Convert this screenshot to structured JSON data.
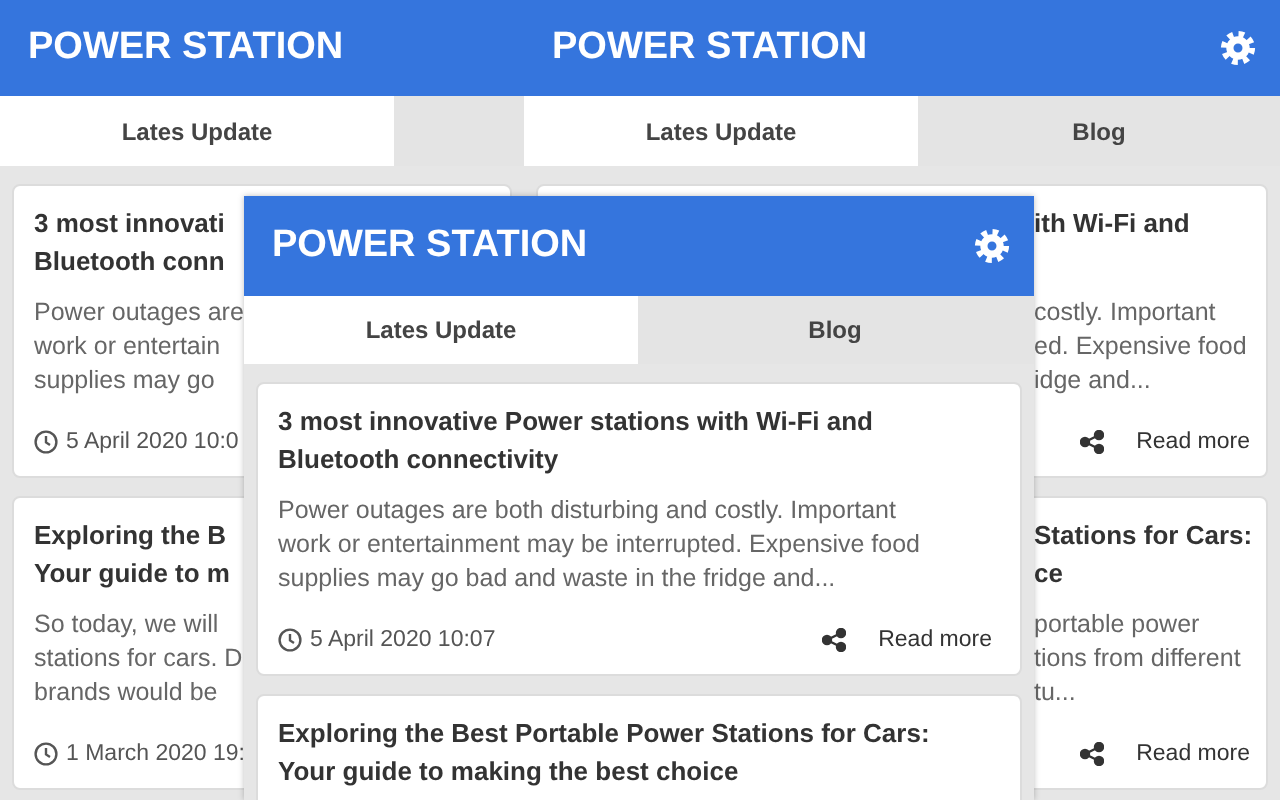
{
  "windows": [
    {
      "kind": "back-left",
      "header": {
        "title": "POWER STATION"
      },
      "tabs": [
        {
          "label": "Lates Update",
          "selected": true
        }
      ],
      "cards": [
        {
          "title_lines": [
            "3 most innovati",
            "Bluetooth conn"
          ],
          "excerpt_lines": [
            "Power outages are",
            "work or entertain",
            "supplies may go"
          ],
          "date": "5 April 2020 10:0"
        },
        {
          "title_lines": [
            "Exploring the B",
            "Your guide to m"
          ],
          "excerpt_lines": [
            "So today, we will",
            "stations for cars. D",
            "brands would be"
          ],
          "date": "1 March 2020 19:"
        }
      ]
    },
    {
      "kind": "back-right",
      "header": {
        "title": "POWER STATION",
        "settings_icon": true
      },
      "tabs": [
        {
          "label": "Lates Update",
          "selected": true
        },
        {
          "label": "Blog",
          "selected": false
        }
      ],
      "cards": [
        {
          "title_lines": [
            "ith Wi-Fi and"
          ],
          "excerpt_lines": [
            "costly. Important",
            "ed. Expensive food",
            "idge and..."
          ],
          "read_more": "Read more"
        },
        {
          "title_lines": [
            "Stations for Cars:",
            "ce"
          ],
          "excerpt_lines": [
            "portable power",
            "tions from different",
            "tu..."
          ],
          "read_more": "Read more"
        }
      ]
    },
    {
      "kind": "front",
      "header": {
        "title": "POWER STATION",
        "settings_icon": true
      },
      "tabs": [
        {
          "label": "Lates Update",
          "selected": true
        },
        {
          "label": "Blog",
          "selected": false
        }
      ],
      "cards": [
        {
          "title_lines": [
            "3 most innovative Power stations with Wi-Fi and",
            "Bluetooth connectivity"
          ],
          "excerpt_lines": [
            "Power outages are both disturbing and costly. Important",
            "work or entertainment may be interrupted. Expensive food",
            "supplies may go bad and waste in the fridge and..."
          ],
          "date": "5 April 2020 10:07",
          "read_more": "Read more"
        },
        {
          "title_lines": [
            "Exploring the Best Portable Power Stations for Cars:",
            "Your guide to making the best choice"
          ]
        }
      ]
    }
  ]
}
